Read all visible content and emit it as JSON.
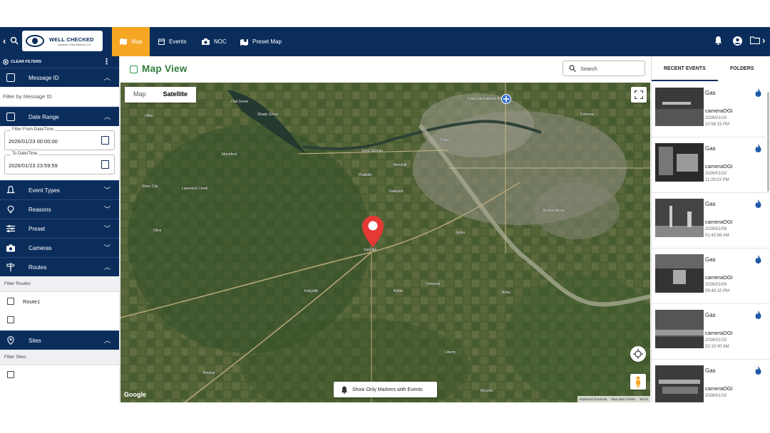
{
  "topbar": {
    "logo_title": "WELL CHECKED",
    "logo_subtitle": "Systems International LLC",
    "tabs": [
      {
        "label": "Map",
        "active": true
      },
      {
        "label": "Events",
        "active": false
      },
      {
        "label": "NOC",
        "active": false
      },
      {
        "label": "Preset Map",
        "active": false
      }
    ]
  },
  "sidebar": {
    "clear_filters": "CLEAR FILTERS",
    "sections": {
      "message_id": "Message ID",
      "date_range": "Date Range",
      "event_types": "Event Types",
      "reasons": "Reasons",
      "preset": "Preset",
      "cameras": "Cameras",
      "routes": "Routes",
      "sites": "Sites"
    },
    "message_filter_placeholder": "Filter by Message ID",
    "date_from_label": "Filter From Date/Time",
    "date_from_value": "2026/01/23 00:00:00",
    "date_to_label": "To Date/Time",
    "date_to_value": "2026/01/23 23:59:59",
    "filter_routes": "Filter Routes",
    "routes": [
      "Route1",
      ""
    ],
    "filter_sites": "Filter Sites"
  },
  "main": {
    "title": "Map View",
    "search_placeholder": "Search"
  },
  "map": {
    "type_options": [
      "Map",
      "Satellite"
    ],
    "selected_type": "Satellite",
    "markers_button": "Show Only Markers with Events",
    "attribution": "Google",
    "footer": [
      "Keyboard shortcuts",
      "Map data ©2026",
      "Terms"
    ],
    "place_labels": [
      "Tulsa",
      "Sapulpa",
      "Kellyville",
      "Kiefer",
      "Glenpool",
      "Bixby",
      "Mannford",
      "Sand Springs",
      "Bristow",
      "Liberty",
      "Mounds",
      "Prattville",
      "Lawrence Creek",
      "Silver City",
      "Olive",
      "Oak Grove",
      "Shady Grove",
      "Berryhill",
      "Oakhurst",
      "Jenks",
      "Catoosa",
      "Broken Arrow",
      "Tulsa International Airport"
    ]
  },
  "right_panel": {
    "tabs": [
      "RECENT EVENTS",
      "FOLDERS"
    ],
    "active_tab": "RECENT EVENTS",
    "events": [
      {
        "type": "Gas",
        "camera": "cameraOGI",
        "date": "2026/01/10",
        "time": "10:58:15 PM"
      },
      {
        "type": "Gas",
        "camera": "cameraOGI",
        "date": "2026/01/10",
        "time": "11:26:03 PM"
      },
      {
        "type": "Gas",
        "camera": "cameraOGI",
        "date": "2026/01/08",
        "time": "01:42:56 AM"
      },
      {
        "type": "Gas",
        "camera": "cameraOGI",
        "date": "2026/01/09",
        "time": "09:49:10 PM"
      },
      {
        "type": "Gas",
        "camera": "cameraOGI",
        "date": "2026/01/10",
        "time": "10:10:00 AM"
      },
      {
        "type": "Gas",
        "camera": "cameraOGI",
        "date": "2026/01/10",
        "time": ""
      }
    ]
  },
  "colors": {
    "navy": "#0b2d5c",
    "accent": "#f5a623",
    "map_title_green": "#2e7d3a",
    "flame_blue": "#1e5aa8",
    "marker_red": "#e53935"
  }
}
